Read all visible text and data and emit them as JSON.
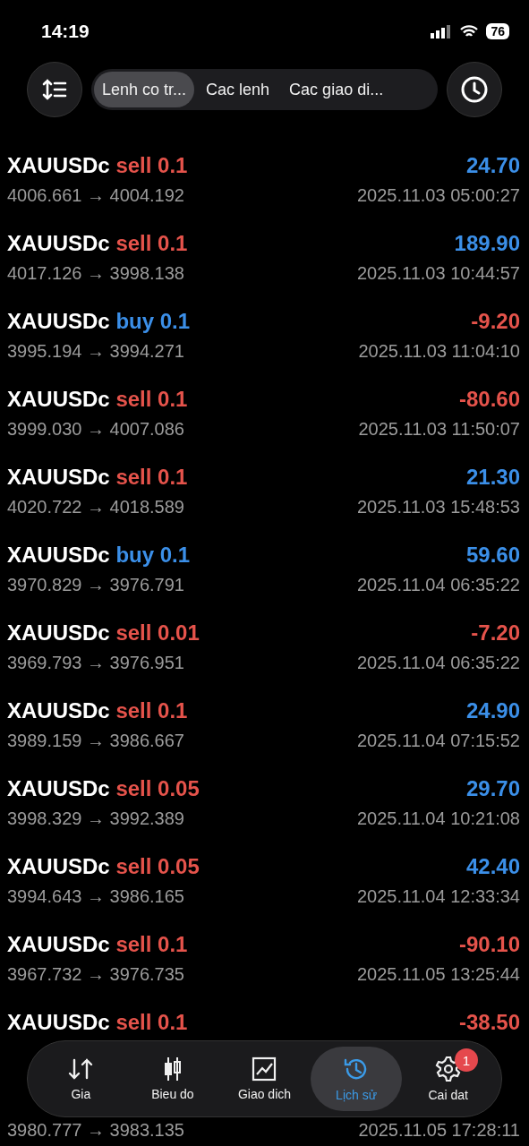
{
  "status_bar": {
    "time": "14:19",
    "battery": "76"
  },
  "header": {
    "tabs": [
      {
        "label": "Lenh co tr...",
        "selected": true
      },
      {
        "label": "Cac lenh",
        "selected": false
      },
      {
        "label": "Cac giao di...",
        "selected": false
      }
    ]
  },
  "rows": [
    {
      "symbol": "XAUUSDc",
      "side": {
        "text": "sell 0.1",
        "color": "#e5534b"
      },
      "profit": {
        "text": "24.70",
        "color": "#3b8fe8"
      },
      "prices": "4006.661 → 4004.192",
      "time": "2025.11.03 05:00:27"
    },
    {
      "symbol": "XAUUSDc",
      "side": {
        "text": "sell 0.1",
        "color": "#e5534b"
      },
      "profit": {
        "text": "189.90",
        "color": "#3b8fe8"
      },
      "prices": "4017.126 → 3998.138",
      "time": "2025.11.03 10:44:57"
    },
    {
      "symbol": "XAUUSDc",
      "side": {
        "text": "buy 0.1",
        "color": "#3b8fe8"
      },
      "profit": {
        "text": "-9.20",
        "color": "#e5534b"
      },
      "prices": "3995.194 → 3994.271",
      "time": "2025.11.03 11:04:10"
    },
    {
      "symbol": "XAUUSDc",
      "side": {
        "text": "sell 0.1",
        "color": "#e5534b"
      },
      "profit": {
        "text": "-80.60",
        "color": "#e5534b"
      },
      "prices": "3999.030 → 4007.086",
      "time": "2025.11.03 11:50:07"
    },
    {
      "symbol": "XAUUSDc",
      "side": {
        "text": "sell 0.1",
        "color": "#e5534b"
      },
      "profit": {
        "text": "21.30",
        "color": "#3b8fe8"
      },
      "prices": "4020.722 → 4018.589",
      "time": "2025.11.03 15:48:53"
    },
    {
      "symbol": "XAUUSDc",
      "side": {
        "text": "buy 0.1",
        "color": "#3b8fe8"
      },
      "profit": {
        "text": "59.60",
        "color": "#3b8fe8"
      },
      "prices": "3970.829 → 3976.791",
      "time": "2025.11.04 06:35:22"
    },
    {
      "symbol": "XAUUSDc",
      "side": {
        "text": "sell 0.01",
        "color": "#e5534b"
      },
      "profit": {
        "text": "-7.20",
        "color": "#e5534b"
      },
      "prices": "3969.793 → 3976.951",
      "time": "2025.11.04 06:35:22"
    },
    {
      "symbol": "XAUUSDc",
      "side": {
        "text": "sell 0.1",
        "color": "#e5534b"
      },
      "profit": {
        "text": "24.90",
        "color": "#3b8fe8"
      },
      "prices": "3989.159 → 3986.667",
      "time": "2025.11.04 07:15:52"
    },
    {
      "symbol": "XAUUSDc",
      "side": {
        "text": "sell 0.05",
        "color": "#e5534b"
      },
      "profit": {
        "text": "29.70",
        "color": "#3b8fe8"
      },
      "prices": "3998.329 → 3992.389",
      "time": "2025.11.04 10:21:08"
    },
    {
      "symbol": "XAUUSDc",
      "side": {
        "text": "sell 0.05",
        "color": "#e5534b"
      },
      "profit": {
        "text": "42.40",
        "color": "#3b8fe8"
      },
      "prices": "3994.643 → 3986.165",
      "time": "2025.11.04 12:33:34"
    },
    {
      "symbol": "XAUUSDc",
      "side": {
        "text": "sell 0.1",
        "color": "#e5534b"
      },
      "profit": {
        "text": "-90.10",
        "color": "#e5534b"
      },
      "prices": "3967.732 → 3976.735",
      "time": "2025.11.05 13:25:44"
    },
    {
      "symbol": "XAUUSDc",
      "side": {
        "text": "sell 0.1",
        "color": "#e5534b"
      },
      "profit": {
        "text": "-38.50",
        "color": "#e5534b"
      }
    },
    {
      "prices": "3980.777 → 3983.135",
      "time": "2025.11.05 17:28:11"
    }
  ],
  "nav": [
    {
      "label": "Gia",
      "selected": false
    },
    {
      "label": "Bieu do",
      "selected": false
    },
    {
      "label": "Giao dich",
      "selected": false
    },
    {
      "label": "Lịch sử",
      "selected": true
    },
    {
      "label": "Cai dat",
      "selected": false,
      "badge": "1"
    }
  ]
}
